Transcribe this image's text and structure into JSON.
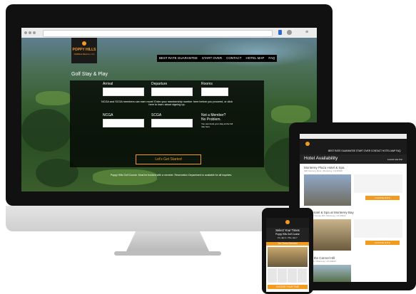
{
  "desktop": {
    "logo": {
      "name": "POPPY HILLS",
      "sub": "PEBBLE BEACH, CA"
    },
    "nav": [
      "BEST RATE GUARANTEE",
      "START OVER",
      "CONTACT",
      "HOTEL MAP",
      "FAQ"
    ],
    "form": {
      "title": "Golf Stay & Play",
      "arrival_label": "Arrival",
      "departure_label": "Departure",
      "rooms_label": "Rooms",
      "ncga_note": "NCGA and SCGA members can earn more! Enter your membership number here before you proceed, or click here to learn about signing up.",
      "ncga_label": "NCGA",
      "scga_label": "SCGA",
      "not_member": "Not a Member?",
      "no_problem": "No Problem.",
      "member_small": "You can book your stay at the full rate here",
      "cta": "Let's Get Started"
    },
    "footer": "Poppy Hills Golf Course. Must be booked with a member. Reservation Department is available for all inquiries."
  },
  "tablet": {
    "nav": "BEST RATE GUARANTEE  START OVER  CONTACT  HOTEL MAP  FAQ",
    "title": "Hotel Availability",
    "sort": "Lowest rate first",
    "hotels": [
      {
        "name": "Monterey Plaza Hotel & Spa",
        "addr": "400 Cannery Row • Monterey, CA 93940"
      },
      {
        "name": "Hyatt Hotel & Spa at Monterey Bay",
        "addr": "1 Old Golf Course Rd • Monterey, CA 93940"
      },
      {
        "name": "Inn on the Carmel Hill",
        "addr": "Carmel Hill • Monterey, CA 93940"
      }
    ],
    "rate_button": "CHOOSE RATE"
  },
  "phone": {
    "title": "Select Your Times",
    "course": "Poppy Hills Golf Course",
    "date": "Fri, Jan 1 • Thu, Jan 7",
    "banner": "Tee Times Selected",
    "cta": "CHOOSE YOUR TIME"
  }
}
